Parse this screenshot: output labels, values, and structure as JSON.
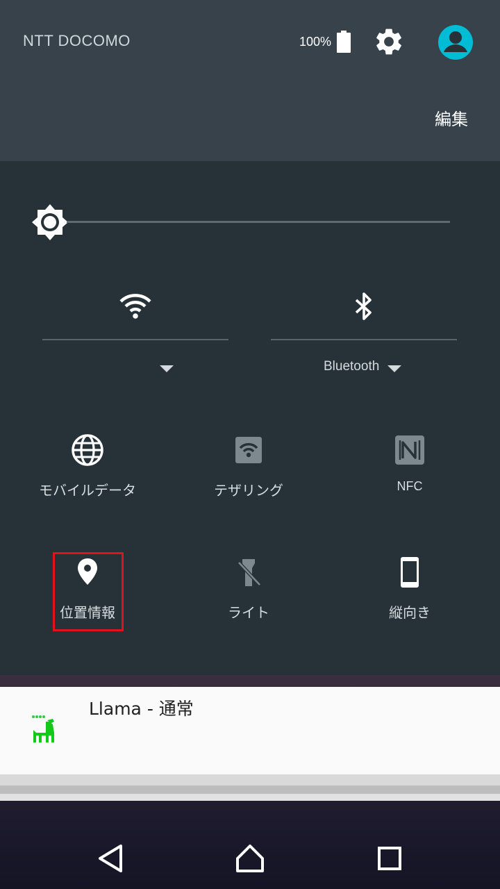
{
  "status": {
    "carrier": "NTT DOCOMO",
    "battery_percent": "100%"
  },
  "header": {
    "edit_label": "編集"
  },
  "quick_settings": {
    "wifi": {
      "label": "",
      "icon": "wifi-icon"
    },
    "bluetooth": {
      "label": "Bluetooth",
      "icon": "bluetooth-icon"
    },
    "tiles": [
      {
        "label": "モバイルデータ",
        "icon": "globe-icon"
      },
      {
        "label": "テザリング",
        "icon": "tethering-icon"
      },
      {
        "label": "NFC",
        "icon": "nfc-icon"
      },
      {
        "label": "位置情報",
        "icon": "location-pin-icon"
      },
      {
        "label": "ライト",
        "icon": "flashlight-off-icon"
      },
      {
        "label": "縦向き",
        "icon": "portrait-phone-icon"
      }
    ]
  },
  "notification": {
    "title": "Llama - 通常",
    "icon": "llama-icon"
  },
  "colors": {
    "header_bg": "#37424a",
    "panel_bg": "#263238",
    "avatar_accent": "#00bcd4",
    "highlight": "#e0121c"
  }
}
